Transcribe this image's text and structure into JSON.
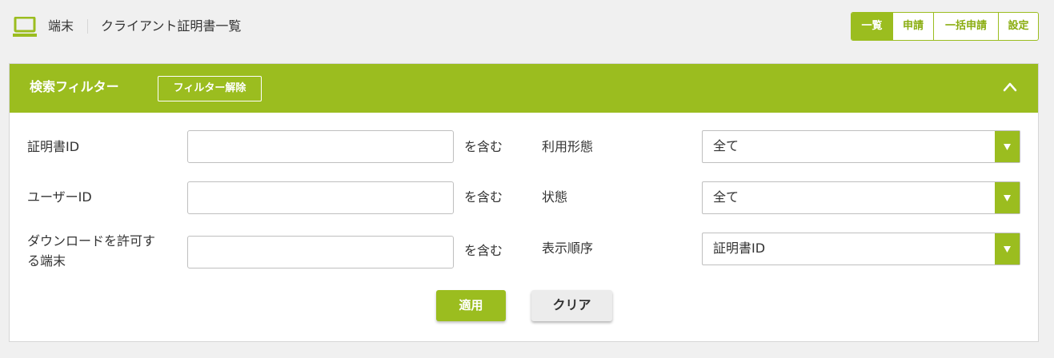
{
  "header": {
    "icon": "laptop-icon",
    "breadcrumb_section": "端末",
    "breadcrumb_page": "クライアント証明書一覧",
    "tabs": [
      "一覧",
      "申請",
      "一括申請",
      "設定"
    ],
    "active_tab": "一覧"
  },
  "filter": {
    "title": "検索フィルター",
    "clear_filter_label": "フィルター解除",
    "collapse_icon": "chevron-up-icon",
    "fields": {
      "certificate_id": {
        "label": "証明書ID",
        "value": "",
        "suffix": "を含む"
      },
      "user_id": {
        "label": "ユーザーID",
        "value": "",
        "suffix": "を含む"
      },
      "allowed_device": {
        "label_line1": "ダウンロードを許可す",
        "label_line2": "る端末",
        "value": "",
        "suffix": "を含む"
      }
    },
    "selects": {
      "usage": {
        "label": "利用形態",
        "value": "全て"
      },
      "status": {
        "label": "状態",
        "value": "全て"
      },
      "order": {
        "label": "表示順序",
        "value": "証明書ID"
      }
    },
    "apply_label": "適用",
    "clear_label": "クリア"
  },
  "colors": {
    "accent": "#9bbd1f",
    "background": "#f0f0f0"
  }
}
